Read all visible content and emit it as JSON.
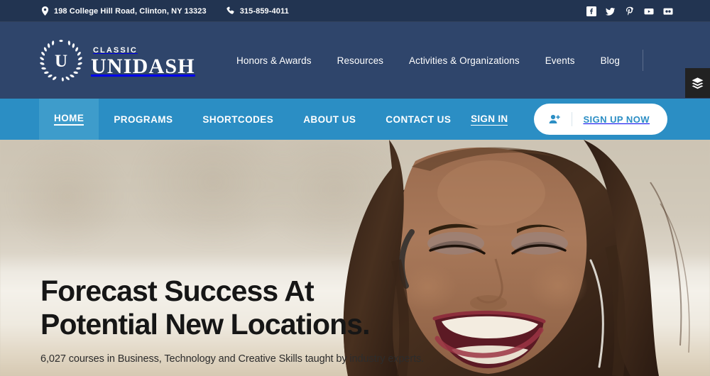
{
  "topbar": {
    "address": "198 College Hill Road, Clinton, NY 13323",
    "phone": "315-859-4011",
    "address_icon": "map-pin-icon",
    "phone_icon": "phone-icon",
    "social": [
      {
        "name": "facebook-icon",
        "label": "Facebook"
      },
      {
        "name": "twitter-icon",
        "label": "Twitter"
      },
      {
        "name": "pinterest-icon",
        "label": "Pinterest"
      },
      {
        "name": "youtube-icon",
        "label": "YouTube"
      },
      {
        "name": "flickr-icon",
        "label": "Flickr"
      }
    ]
  },
  "header": {
    "logo": {
      "mark": "laurel-wreath-u-icon",
      "eyebrow": "CLASSIC",
      "name": "UNIDASH"
    },
    "nav": [
      {
        "label": "Honors & Awards"
      },
      {
        "label": "Resources"
      },
      {
        "label": "Activities & Organizations"
      },
      {
        "label": "Events"
      },
      {
        "label": "Blog"
      }
    ],
    "search_icon": "search-icon"
  },
  "side_tab": {
    "icon": "layers-icon"
  },
  "mainnav": {
    "items": [
      {
        "label": "HOME",
        "active": true
      },
      {
        "label": "PROGRAMS",
        "active": false
      },
      {
        "label": "SHORTCODES",
        "active": false
      },
      {
        "label": "ABOUT US",
        "active": false
      },
      {
        "label": "CONTACT US",
        "active": false
      }
    ],
    "signin_label": "SIGN IN",
    "signup_label": "SIGN UP NOW",
    "signup_icon": "add-user-icon"
  },
  "hero": {
    "title_line1": "Forecast Success At",
    "title_line2": "Potential New Locations.",
    "subtitle": "6,027 courses in Business, Technology and Creative Skills taught by industry experts.",
    "image_alt": "smiling-woman-with-headset"
  },
  "colors": {
    "topbar_bg": "#223451",
    "header_bg": "#2f456b",
    "nav_bg": "#2b8ec4",
    "nav_active_bg": "#3e9ccb",
    "accent": "#2b8ec4",
    "side_tab_bg": "#222222",
    "hero_text": "#161616"
  }
}
